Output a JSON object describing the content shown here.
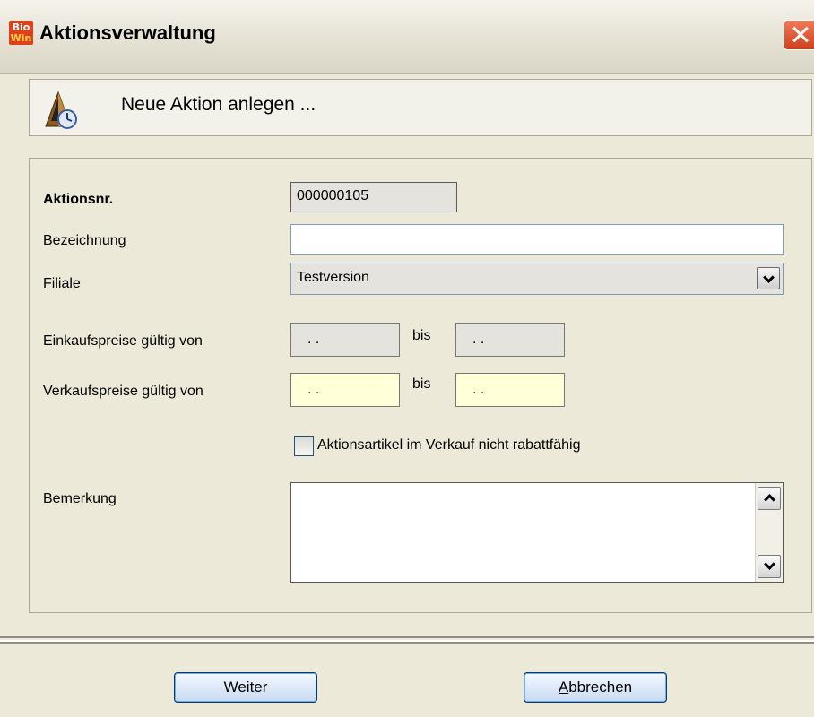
{
  "window": {
    "title": "Aktionsverwaltung",
    "logo_top": "Bio",
    "logo_bottom": "Win"
  },
  "header": {
    "text": "Neue Aktion anlegen ..."
  },
  "form": {
    "aktionsnr_label": "Aktionsnr.",
    "aktionsnr_value": "000000105",
    "bezeichnung_label": "Bezeichnung",
    "bezeichnung_value": "",
    "filiale_label": "Filiale",
    "filiale_value": "Testversion",
    "einkauf_label": "Einkaufspreise gültig von",
    "einkauf_von": ". .",
    "einkauf_bis_label": "bis",
    "einkauf_bis": ". .",
    "verkauf_label": "Verkaufspreise gültig von",
    "verkauf_von": ". .",
    "verkauf_bis_label": "bis",
    "verkauf_bis": ". .",
    "checkbox_label": "Aktionsartikel im Verkauf nicht rabattfähig",
    "checkbox_checked": false,
    "bemerkung_label": "Bemerkung",
    "bemerkung_value": ""
  },
  "buttons": {
    "weiter": "Weiter",
    "abbrechen_first": "A",
    "abbrechen_rest": "bbrechen"
  },
  "colors": {
    "window_bg": "#ece9d8",
    "required_field": "#ffffd8",
    "close_button": "#d0401c"
  }
}
